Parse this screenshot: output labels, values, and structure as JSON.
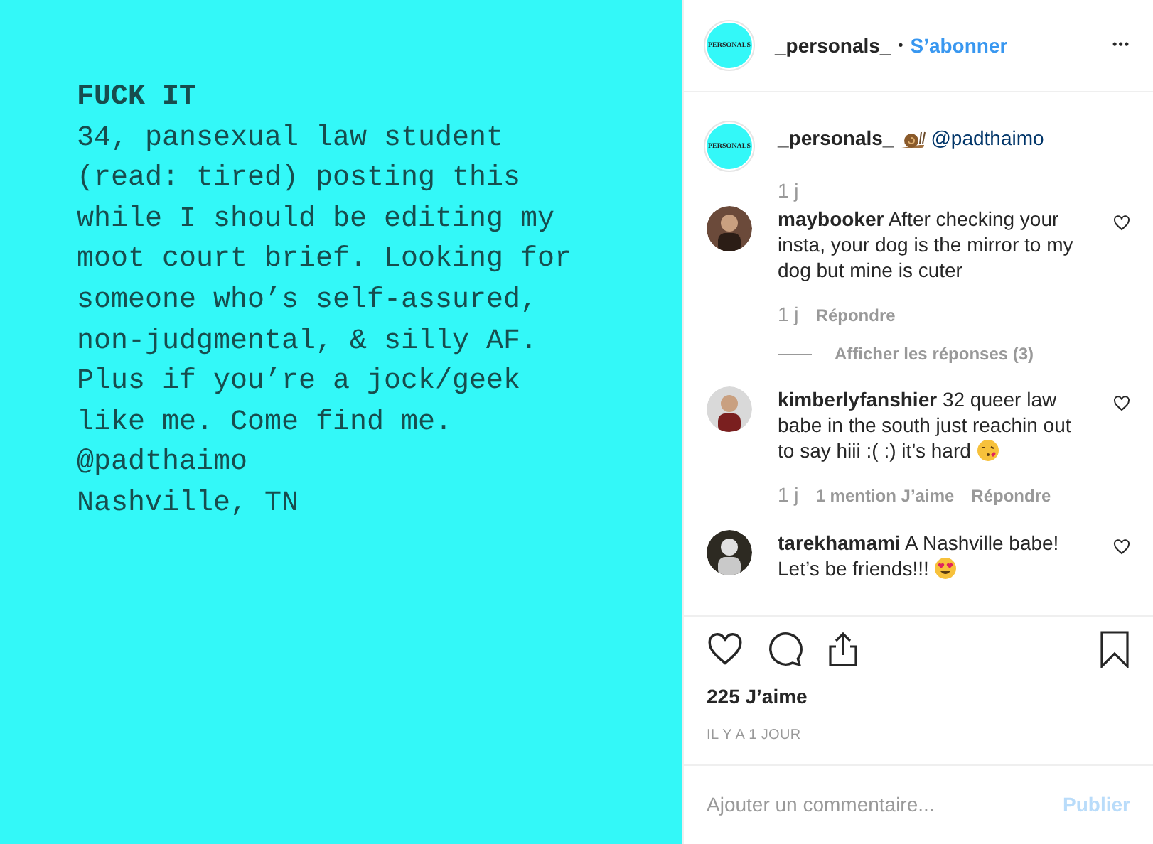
{
  "post_image": {
    "title": "FUCK IT",
    "lines": [
      "34, pansexual law student",
      "(read: tired) posting this",
      "while I should be editing my",
      "moot court brief. Looking for",
      "someone who’s self-assured,",
      "non-judgmental, & silly AF.",
      "Plus if you’re a jock/geek",
      "like me. Come find me.",
      "@padthaimo",
      "Nashville, TN"
    ]
  },
  "header": {
    "avatar_text": "PERSONALS",
    "username": "_personals_",
    "separator": "•",
    "follow": "S’abonner",
    "more": "•••"
  },
  "caption": {
    "avatar_text": "PERSONALS",
    "username": "_personals_",
    "mention": "@padthaimo",
    "time": "1 j"
  },
  "comments": [
    {
      "kind": "plain",
      "username": "maybooker",
      "text": "After checking your insta, your dog is the mirror to my dog but mine is cuter",
      "time": "1 j",
      "reply": "Répondre",
      "view_replies": "Afficher les réponses (3)"
    },
    {
      "kind": "kiss",
      "username": "kimberlyfanshier",
      "text": "32 queer law babe in the south just reachin out to say hiii :( :) it’s hard",
      "time": "1 j",
      "likes": "1 mention J’aime",
      "reply": "Répondre"
    },
    {
      "kind": "hearteyes",
      "username": "tarekhamami",
      "text": "A Nashville babe! Let’s be friends!!!"
    }
  ],
  "likes": "225 J’aime",
  "date": "IL Y A 1 JOUR",
  "comment_box": {
    "placeholder": "Ajouter un commentaire...",
    "publish": "Publier",
    "disabled": true
  }
}
